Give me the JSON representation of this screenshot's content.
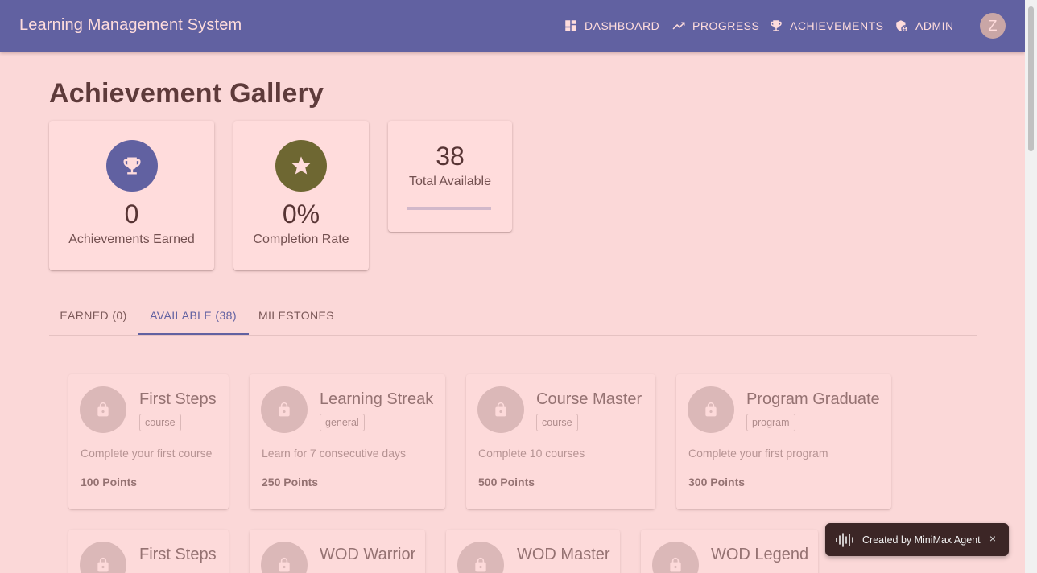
{
  "colors": {
    "primary": "#3f6ab8",
    "trophy_circle": "#3f6ab8",
    "star_circle": "#4f7130",
    "locked_circle": "#bdbdbd"
  },
  "appbar": {
    "title": "Learning Management System",
    "nav": [
      {
        "label": "DASHBOARD",
        "icon": "dashboard-icon"
      },
      {
        "label": "PROGRESS",
        "icon": "trending-up-icon"
      },
      {
        "label": "ACHIEVEMENTS",
        "icon": "trophy-icon"
      },
      {
        "label": "ADMIN",
        "icon": "admin-shield-icon"
      }
    ],
    "avatar_letter": "Z"
  },
  "page": {
    "title": "Achievement Gallery"
  },
  "stats": {
    "earned": {
      "value": "0",
      "label": "Achievements Earned",
      "icon": "trophy-icon"
    },
    "completion": {
      "value": "0%",
      "label": "Completion Rate",
      "icon": "star-icon"
    },
    "total": {
      "value": "38",
      "label": "Total Available",
      "progress": 0
    }
  },
  "tabs": [
    {
      "label": "EARNED (0)"
    },
    {
      "label": "AVAILABLE (38)"
    },
    {
      "label": "MILESTONES"
    }
  ],
  "active_tab": 1,
  "achievements": [
    {
      "title": "First Steps",
      "category": "course",
      "description": "Complete your first course",
      "points": "100 Points",
      "icon": "lock-icon"
    },
    {
      "title": "Learning Streak",
      "category": "general",
      "description": "Learn for 7 consecutive days",
      "points": "250 Points",
      "icon": "lock-icon"
    },
    {
      "title": "Course Master",
      "category": "course",
      "description": "Complete 10 courses",
      "points": "500 Points",
      "icon": "lock-icon"
    },
    {
      "title": "Program Graduate",
      "category": "program",
      "description": "Complete your first program",
      "points": "300 Points",
      "icon": "lock-icon"
    },
    {
      "title": "First Steps",
      "icon": "lock-icon"
    },
    {
      "title": "WOD Warrior",
      "icon": "lock-icon"
    },
    {
      "title": "WOD Master",
      "icon": "lock-icon"
    },
    {
      "title": "WOD Legend",
      "icon": "lock-icon"
    }
  ],
  "toast": {
    "text": "Created by MiniMax Agent",
    "close": "×"
  }
}
